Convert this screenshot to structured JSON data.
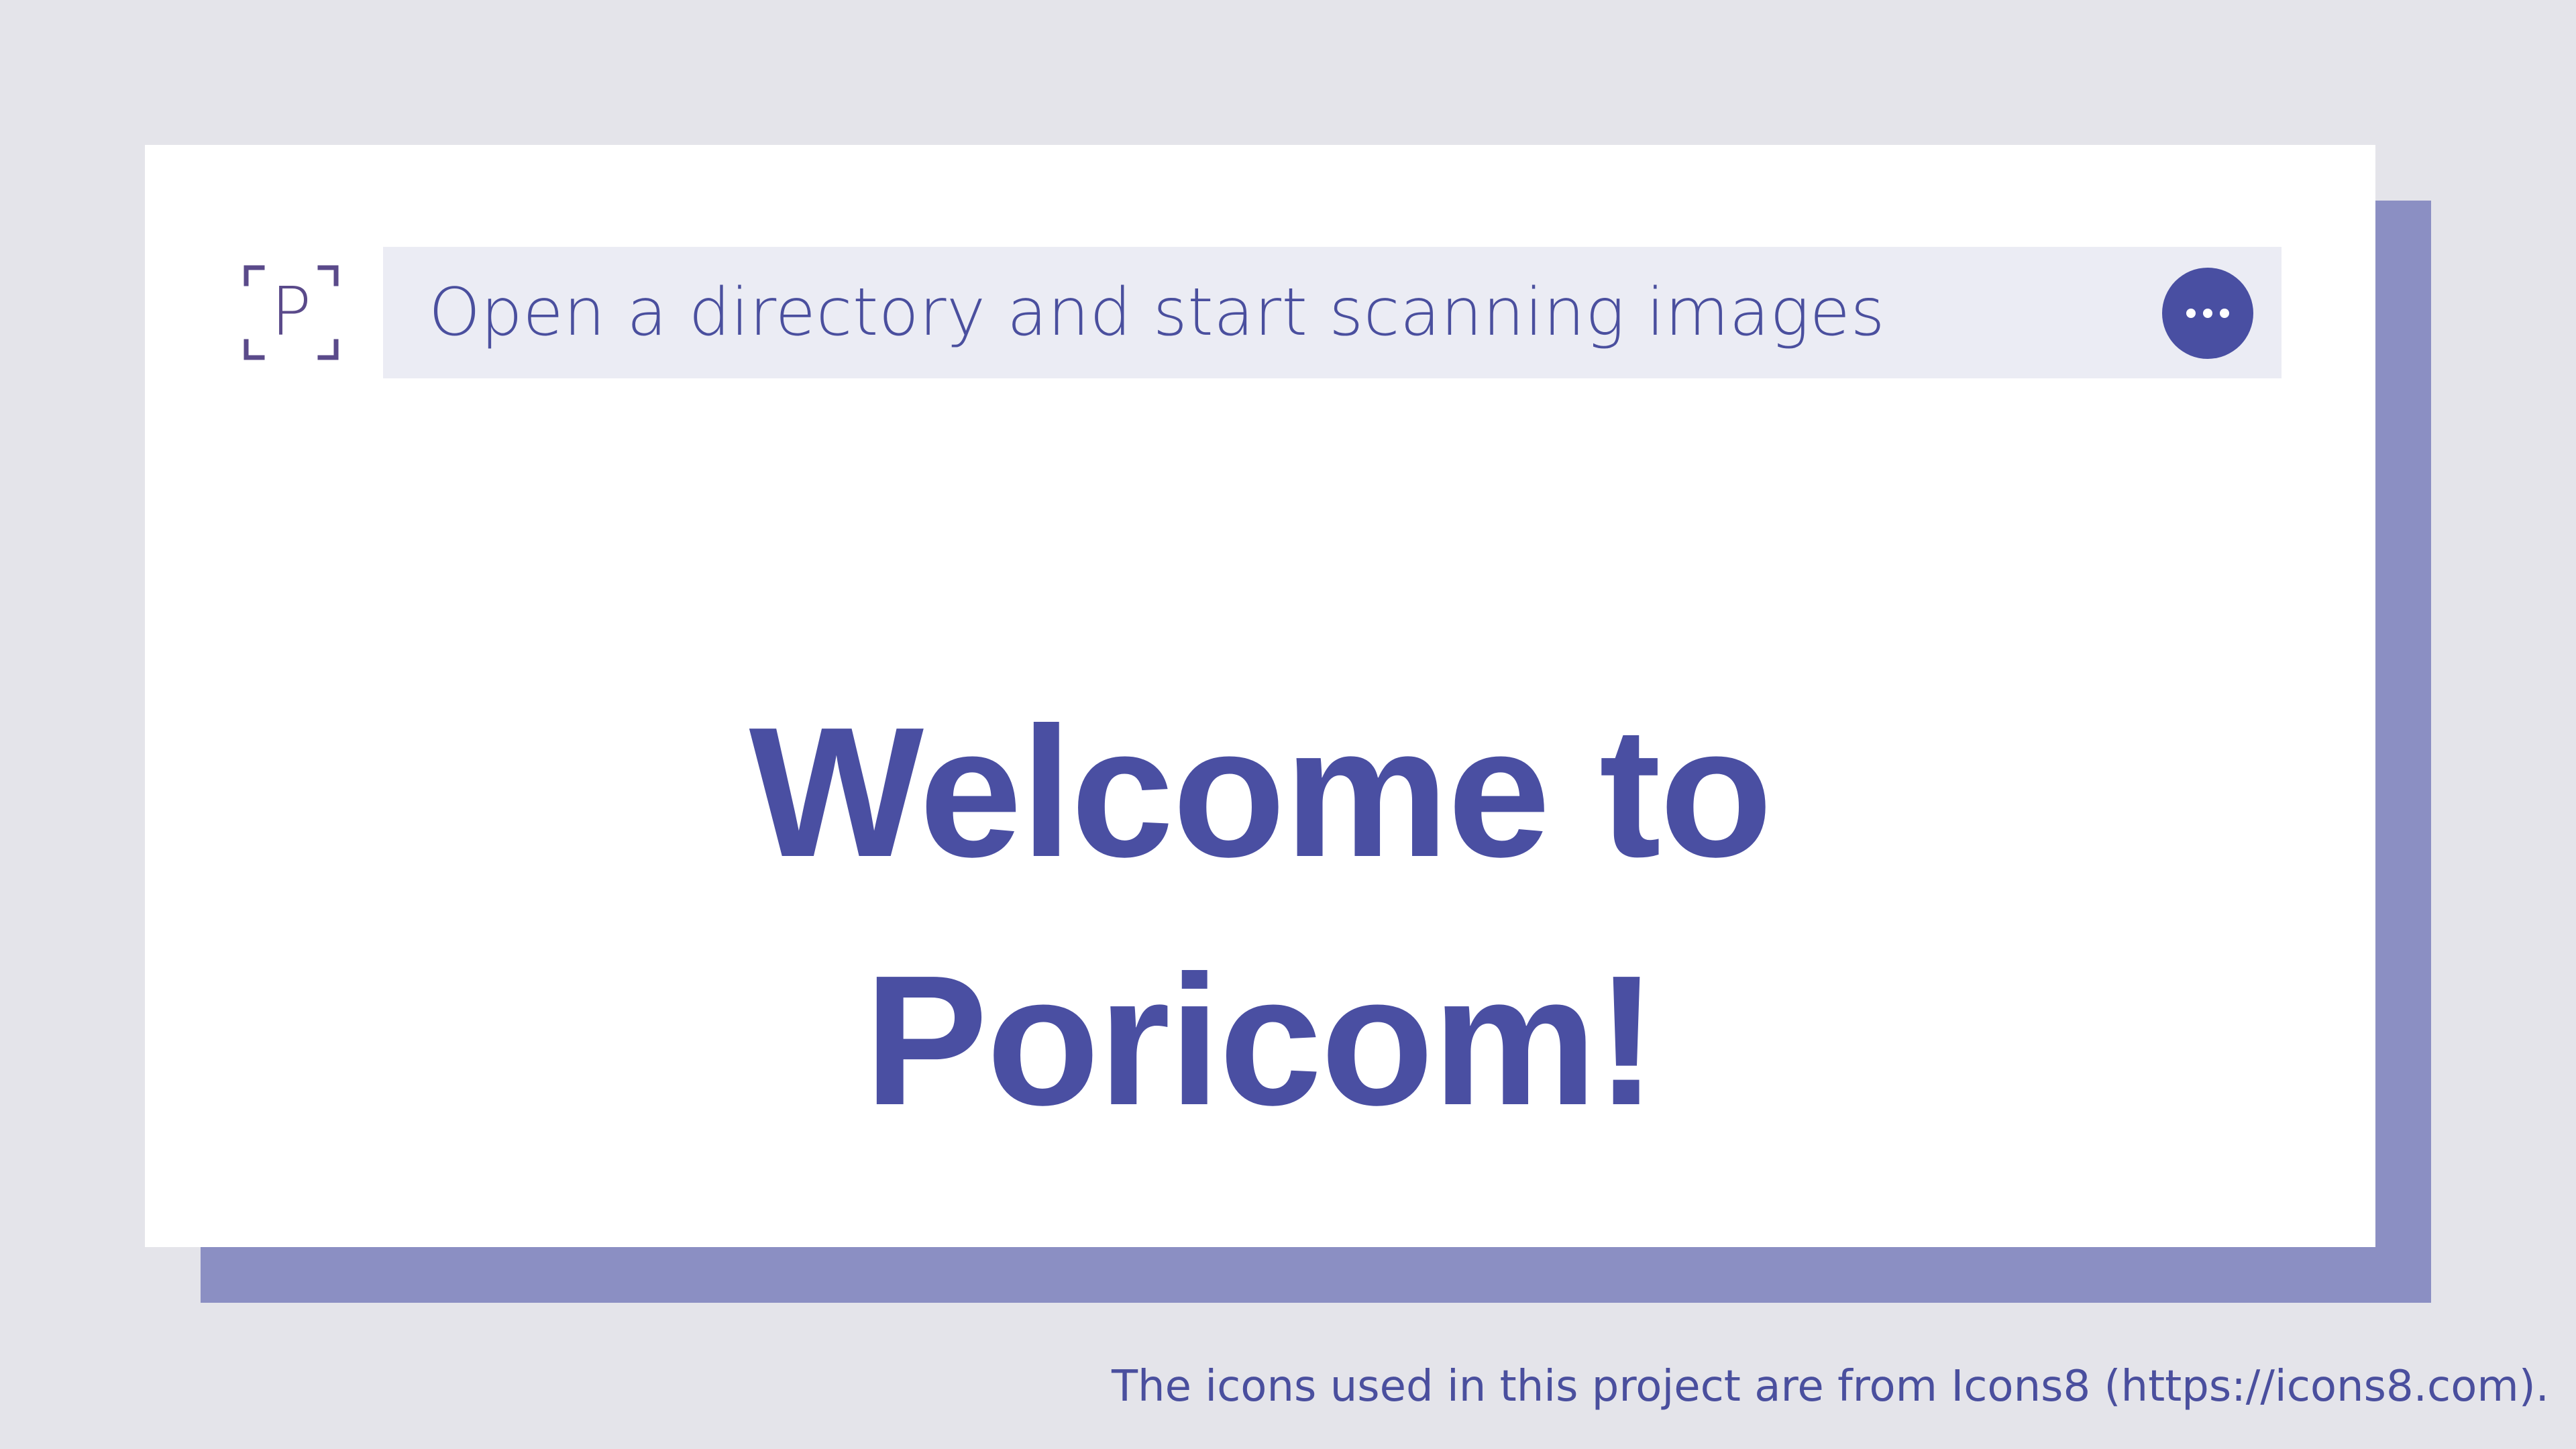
{
  "colors": {
    "background": "#e4e4ea",
    "card": "#ffffff",
    "shadow": "#8b8fc3",
    "accent": "#494fa2",
    "search_bg": "#ebecf4",
    "logo": "#5a4a8a"
  },
  "logo": {
    "icon": "poricom-logo-icon",
    "letter": "P"
  },
  "search": {
    "text": "Open a directory and start scanning images",
    "menu_icon": "more-horizontal-icon"
  },
  "welcome": {
    "line1": "Welcome to",
    "line2": "Poricom!"
  },
  "footer": {
    "credit": "The icons used in this project are from Icons8 (https://icons8.com)."
  }
}
